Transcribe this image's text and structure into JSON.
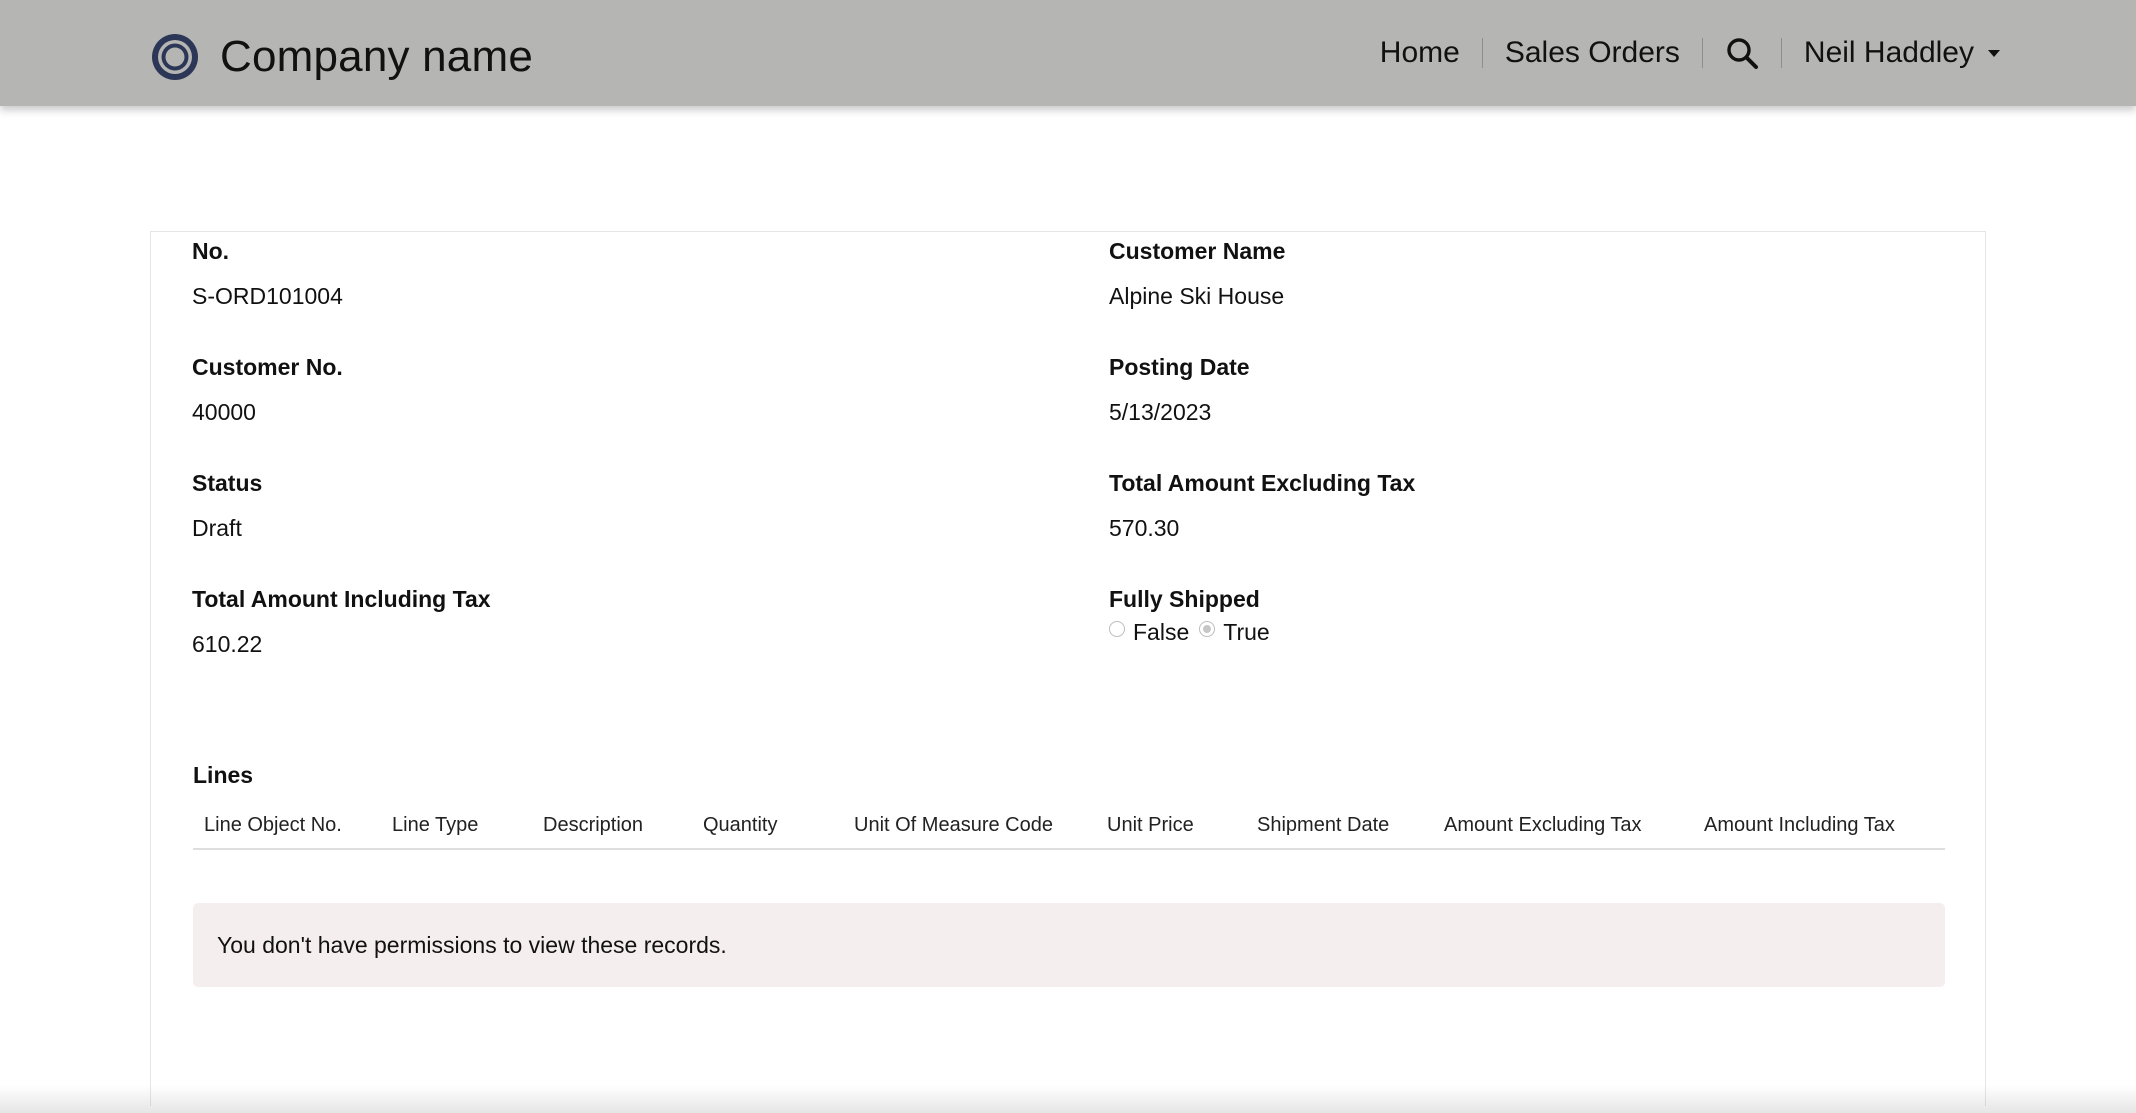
{
  "header": {
    "company_name": "Company name",
    "nav": {
      "home": "Home",
      "sales_orders": "Sales Orders",
      "search_icon": "search-icon",
      "user_name": "Neil Haddley"
    }
  },
  "order": {
    "no_label": "No.",
    "no_value": "S-ORD101004",
    "customer_name_label": "Customer Name",
    "customer_name_value": "Alpine Ski House",
    "customer_no_label": "Customer No.",
    "customer_no_value": "40000",
    "posting_date_label": "Posting Date",
    "posting_date_value": "5/13/2023",
    "status_label": "Status",
    "status_value": "Draft",
    "total_excl_label": "Total Amount Excluding Tax",
    "total_excl_value": "570.30",
    "total_incl_label": "Total Amount Including Tax",
    "total_incl_value": "610.22",
    "fully_shipped_label": "Fully Shipped",
    "fully_shipped_options": [
      "False",
      "True"
    ],
    "fully_shipped_selected": "True"
  },
  "lines": {
    "title": "Lines",
    "columns": [
      "Line Object No.",
      "Line Type",
      "Description",
      "Quantity",
      "Unit Of Measure Code",
      "Unit Price",
      "Shipment Date",
      "Amount Excluding Tax",
      "Amount Including Tax"
    ],
    "message": "You don't have permissions to view these records."
  },
  "colors": {
    "navbar_bg": "#b5b5b4",
    "logo_navy": "#2c3656",
    "alert_bg": "#f5eeee"
  }
}
